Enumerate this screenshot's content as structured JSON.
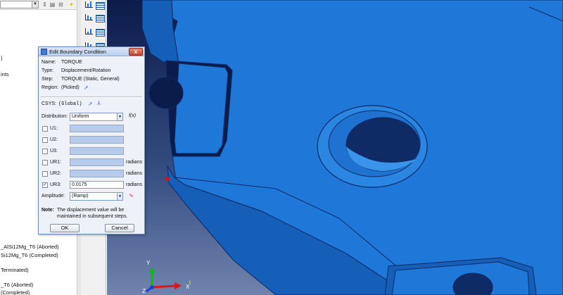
{
  "tree": {
    "lines": [
      {
        "text": ")"
      },
      {
        "text": "ints"
      },
      {
        "text": "_AlSi12Mg_T6 (Aborted)"
      },
      {
        "text": "Si12Mg_T6 (Completed)"
      },
      {
        "text": "Terminated)"
      },
      {
        "text": "_T6 (Aborted)"
      },
      {
        "text": "(Completed)"
      }
    ]
  },
  "dialog": {
    "title": "Edit Boundary Condition",
    "close_label": "x",
    "name_label": "Name:",
    "name_value": "TORQUE",
    "type_label": "Type:",
    "type_value": "Displacement/Rotation",
    "step_label": "Step:",
    "step_value": "TORQUE (Static, General)",
    "region_label": "Region:",
    "region_value": "(Picked)",
    "csys_label": "CSYS:",
    "csys_value": "(Global)",
    "distribution_label": "Distribution:",
    "distribution_value": "Uniform",
    "fx_label": "f(x)",
    "dofs": [
      {
        "label": "U1:",
        "checked": false,
        "value": "",
        "unit": ""
      },
      {
        "label": "U2:",
        "checked": false,
        "value": "",
        "unit": ""
      },
      {
        "label": "U3:",
        "checked": false,
        "value": "",
        "unit": ""
      },
      {
        "label": "UR1:",
        "checked": false,
        "value": "",
        "unit": "radians"
      },
      {
        "label": "UR2:",
        "checked": false,
        "value": "",
        "unit": "radians"
      },
      {
        "label": "UR3:",
        "checked": true,
        "value": "0.0175",
        "unit": "radians"
      }
    ],
    "amplitude_label": "Amplitude:",
    "amplitude_value": "(Ramp)",
    "note_label": "Note:",
    "note_line1": "The displacement value will be",
    "note_line2": "maintained in subsequent steps.",
    "ok_label": "OK",
    "cancel_label": "Cancel"
  },
  "triad": {
    "y_label": "Y",
    "z_label": "Z",
    "x_label": "X"
  },
  "colors": {
    "model_blue": "#1f78d8",
    "model_edge": "#0b2a66",
    "model_side": "#165fb8"
  }
}
